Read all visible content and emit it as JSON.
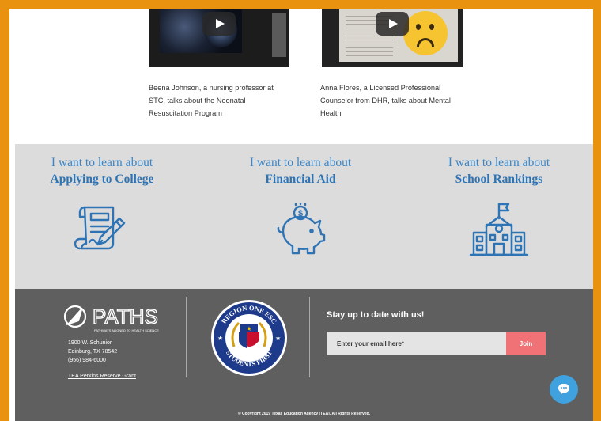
{
  "videos": [
    {
      "caption": "Beena Johnson, a nursing professor at STC, talks about the Neonatal Resuscitation Program",
      "icon": "play-icon"
    },
    {
      "caption": "Anna Flores, a Licensed Professional Counselor from DHR, talks about Mental Health",
      "icon": "play-icon"
    }
  ],
  "learn": {
    "prefix": "I want to learn about",
    "items": [
      {
        "link": "Applying to College",
        "icon": "application-form-icon"
      },
      {
        "link": "Financial Aid",
        "icon": "piggy-bank-icon"
      },
      {
        "link": "School Rankings",
        "icon": "school-building-icon"
      }
    ]
  },
  "footer": {
    "logo_text": "PATHS",
    "logo_tagline": "PATHWAYS ALIGNED TO HEALTH SCIENCE",
    "address": [
      "1900 W. Schunior",
      "Edinburg, TX 78542",
      "(956) 984-6000"
    ],
    "tea_link": "TEA Perkins Reserve Grant",
    "seal": {
      "top": "REGION ONE ESC",
      "bottom": "STUDENTS FIRST"
    },
    "newsletter_title": "Stay up to date with us!",
    "email_placeholder": "Enter your email here*",
    "join_label": "Join",
    "copyright": "© Copyright 2019 Texas Education Agency (TEA). All Rights Reserved."
  },
  "colors": {
    "frame": "#e8920f",
    "accent": "#2e74b5",
    "join": "#f07276",
    "footer": "#5f5f5f",
    "chat": "#3fa2df"
  },
  "chat": {
    "icon": "chat-bubble-icon"
  }
}
